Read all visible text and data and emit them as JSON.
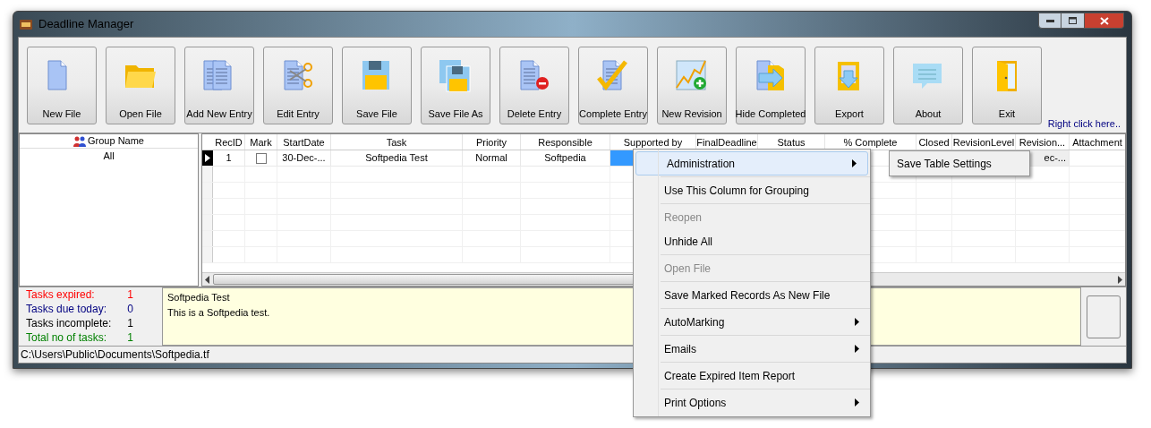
{
  "window": {
    "title": "Deadline Manager"
  },
  "toolbar": [
    {
      "label": "New File"
    },
    {
      "label": "Open File"
    },
    {
      "label": "Add New Entry"
    },
    {
      "label": "Edit Entry"
    },
    {
      "label": "Save File"
    },
    {
      "label": "Save File As"
    },
    {
      "label": "Delete Entry"
    },
    {
      "label": "Complete Entry"
    },
    {
      "label": "New Revision"
    },
    {
      "label": "Hide Completed"
    },
    {
      "label": "Export"
    },
    {
      "label": "About"
    },
    {
      "label": "Exit"
    }
  ],
  "hint_link": "Right click here..",
  "groups": {
    "header": "Group Name",
    "items": [
      {
        "label": "All",
        "selected": false
      }
    ]
  },
  "table": {
    "columns": [
      "RecID",
      "Mark",
      "StartDate",
      "Task",
      "Priority",
      "Responsible",
      "Supported by",
      "FinalDeadline",
      "Status",
      "% Complete",
      "Closed",
      "RevisionLevel",
      "Revision...",
      "Attachment"
    ],
    "rows": [
      {
        "current": true,
        "cells": [
          "1",
          "",
          "30-Dec-...",
          "Softpedia Test",
          "Normal",
          "Softpedia",
          "",
          "",
          "",
          "",
          "",
          "",
          "ec-...",
          ""
        ],
        "mark_checked": false
      }
    ]
  },
  "stats": [
    {
      "label": "Tasks expired:",
      "value": "1",
      "color": "#ff0000"
    },
    {
      "label": "Tasks due today:",
      "value": "0",
      "color": "#000080"
    },
    {
      "label": "Tasks incomplete:",
      "value": "1",
      "color": "#000000"
    },
    {
      "label": "Total no of tasks:",
      "value": "1",
      "color": "#008000"
    }
  ],
  "notes": [
    "Softpedia Test",
    "This is a Softpedia test."
  ],
  "status_bar": "C:\\Users\\Public\\Documents\\Softpedia.tf",
  "context_menu": {
    "groups": [
      [
        {
          "label": "Administration",
          "selected": true,
          "disabled": false,
          "submenu": true
        }
      ],
      [
        {
          "label": "Use This Column for Grouping",
          "selected": false,
          "disabled": false,
          "submenu": false
        }
      ],
      [
        {
          "label": "Reopen",
          "selected": false,
          "disabled": true,
          "submenu": false
        },
        {
          "label": "Unhide All",
          "selected": false,
          "disabled": false,
          "submenu": false
        }
      ],
      [
        {
          "label": "Open File",
          "selected": false,
          "disabled": true,
          "submenu": false
        }
      ],
      [
        {
          "label": "Save Marked Records As New File",
          "selected": false,
          "disabled": false,
          "submenu": false
        }
      ],
      [
        {
          "label": "AutoMarking",
          "selected": false,
          "disabled": false,
          "submenu": true
        }
      ],
      [
        {
          "label": "Emails",
          "selected": false,
          "disabled": false,
          "submenu": true
        }
      ],
      [
        {
          "label": "Create Expired Item Report",
          "selected": false,
          "disabled": false,
          "submenu": false
        }
      ],
      [
        {
          "label": "Print Options",
          "selected": false,
          "disabled": false,
          "submenu": true
        }
      ]
    ],
    "submenu": [
      {
        "label": "Save Table Settings",
        "selected": false
      }
    ]
  }
}
